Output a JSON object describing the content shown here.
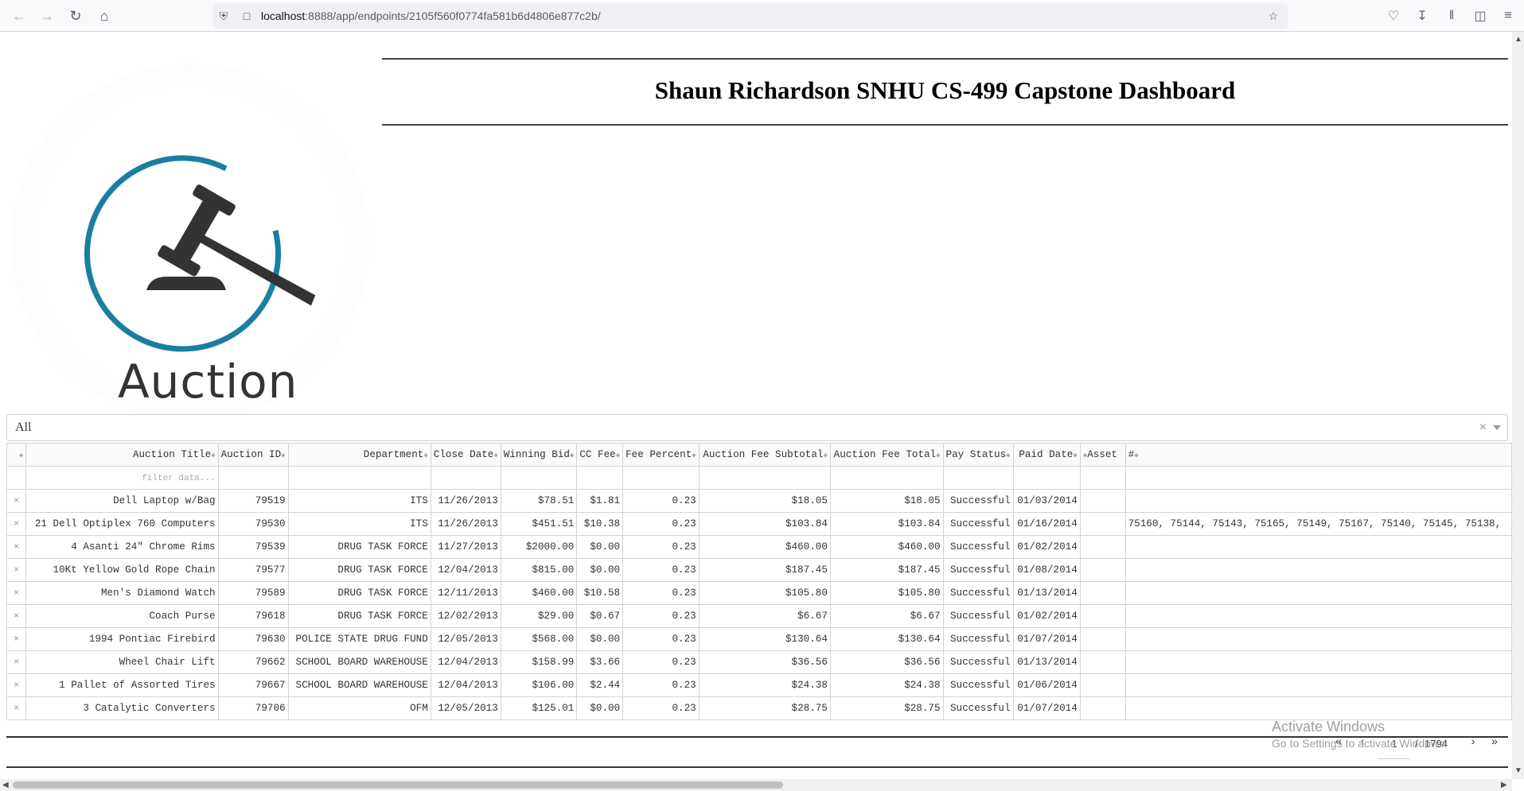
{
  "browser": {
    "url_host": "localhost",
    "url_rest": ":8888/app/endpoints/2105f560f0774fa581b6d4806e877c2b/"
  },
  "logo": {
    "text": "Auction"
  },
  "header": {
    "title": "Shaun Richardson SNHU CS-499 Capstone Dashboard"
  },
  "filter": {
    "selected": "All",
    "clear": "×"
  },
  "table": {
    "columns": [
      "",
      "Auction Title",
      "Auction ID",
      "Department",
      "Close Date",
      "Winning Bid",
      "CC Fee",
      "Fee Percent",
      "Auction Fee Subtotal",
      "Auction Fee Total",
      "Pay Status",
      "Paid Date",
      "Asset",
      "#"
    ],
    "filter_placeholder": "filter data...",
    "delete_glyph": "×",
    "rows": [
      [
        "Dell Laptop w/Bag",
        "79519",
        "ITS",
        "11/26/2013",
        "$78.51",
        "$1.81",
        "0.23",
        "$18.05",
        "$18.05",
        "Successful",
        "01/03/2014",
        "",
        ""
      ],
      [
        "21 Dell Optiplex 760 Computers",
        "79530",
        "ITS",
        "11/26/2013",
        "$451.51",
        "$10.38",
        "0.23",
        "$103.84",
        "$103.84",
        "Successful",
        "01/16/2014",
        "",
        "75160, 75144, 75143, 75165, 75149, 75167, 75140, 75145, 75138,"
      ],
      [
        "4 Asanti 24\" Chrome Rims",
        "79539",
        "DRUG TASK FORCE",
        "11/27/2013",
        "$2000.00",
        "$0.00",
        "0.23",
        "$460.00",
        "$460.00",
        "Successful",
        "01/02/2014",
        "",
        ""
      ],
      [
        "10Kt Yellow Gold Rope Chain",
        "79577",
        "DRUG TASK FORCE",
        "12/04/2013",
        "$815.00",
        "$0.00",
        "0.23",
        "$187.45",
        "$187.45",
        "Successful",
        "01/08/2014",
        "",
        ""
      ],
      [
        "Men's Diamond Watch",
        "79589",
        "DRUG TASK FORCE",
        "12/11/2013",
        "$460.00",
        "$10.58",
        "0.23",
        "$105.80",
        "$105.80",
        "Successful",
        "01/13/2014",
        "",
        ""
      ],
      [
        "Coach Purse",
        "79618",
        "DRUG TASK FORCE",
        "12/02/2013",
        "$29.00",
        "$0.67",
        "0.23",
        "$6.67",
        "$6.67",
        "Successful",
        "01/02/2014",
        "",
        ""
      ],
      [
        "1994 Pontiac Firebird",
        "79630",
        "POLICE STATE DRUG FUND",
        "12/05/2013",
        "$568.00",
        "$0.00",
        "0.23",
        "$130.64",
        "$130.64",
        "Successful",
        "01/07/2014",
        "",
        ""
      ],
      [
        "Wheel Chair Lift",
        "79662",
        "SCHOOL BOARD WAREHOUSE",
        "12/04/2013",
        "$158.99",
        "$3.66",
        "0.23",
        "$36.56",
        "$36.56",
        "Successful",
        "01/13/2014",
        "",
        ""
      ],
      [
        "1 Pallet of Assorted Tires",
        "79667",
        "SCHOOL BOARD WAREHOUSE",
        "12/04/2013",
        "$106.00",
        "$2.44",
        "0.23",
        "$24.38",
        "$24.38",
        "Successful",
        "01/06/2014",
        "",
        ""
      ],
      [
        "3 Catalytic Converters",
        "79706",
        "OFM",
        "12/05/2013",
        "$125.01",
        "$0.00",
        "0.23",
        "$28.75",
        "$28.75",
        "Successful",
        "01/07/2014",
        "",
        ""
      ]
    ]
  },
  "pagination": {
    "current_page": "1",
    "separator": "/",
    "total_pages": "1794",
    "first": "«",
    "prev": "‹",
    "next": "›",
    "last": "»"
  },
  "watermark": {
    "line1": "Activate Windows",
    "line2": "Go to Settings to activate Windows."
  }
}
